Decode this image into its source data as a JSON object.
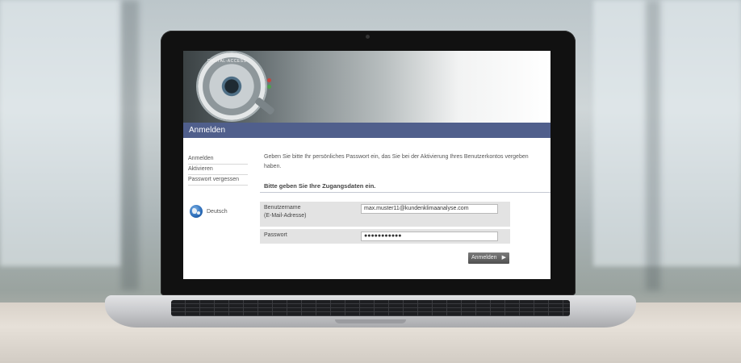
{
  "header": {
    "logo_text": "DIGITAL-ACCESS",
    "title": "Anmelden"
  },
  "sidebar": {
    "items": [
      {
        "label": "Anmelden"
      },
      {
        "label": "Aktivieren"
      },
      {
        "label": "Passwort vergessen"
      }
    ],
    "language": {
      "icon": "globe-icon",
      "label": "Deutsch"
    }
  },
  "main": {
    "intro": "Geben Sie bitte Ihr persönliches Passwort ein, das Sie bei der Aktivierung Ihres Benutzerkontos vergeben haben.",
    "section_heading": "Bitte geben Sie Ihre Zugangsdaten ein.",
    "form": {
      "username_label_line1": "Benutzername",
      "username_label_line2": "(E-Mail-Adresse)",
      "username_value": "max.muster11@kundenklimaanalyse.com",
      "password_label": "Passwort",
      "password_value": "●●●●●●●●●●●"
    },
    "submit_label": "Anmelden",
    "submit_icon": "arrow-right-icon"
  },
  "colors": {
    "titlebar": "#505f8c",
    "button": "#606060",
    "form_bg": "#e3e3e3"
  }
}
